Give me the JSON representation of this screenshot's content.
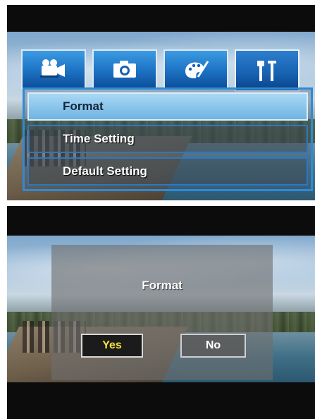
{
  "setup_screen": {
    "tabs": [
      {
        "icon": "movie-camera-icon",
        "active": false
      },
      {
        "icon": "camera-icon",
        "active": false
      },
      {
        "icon": "palette-icon",
        "active": false
      },
      {
        "icon": "tools-icon",
        "active": true
      }
    ],
    "menu_items": [
      {
        "label": "Format",
        "selected": true
      },
      {
        "label": "Time Setting",
        "selected": false
      },
      {
        "label": "Default Setting",
        "selected": false
      }
    ]
  },
  "format_dialog": {
    "title": "Format",
    "yes_label": "Yes",
    "no_label": "No",
    "selected": "Yes"
  },
  "colors": {
    "tab_blue": "#1c72c3",
    "menu_border": "#2c8bd9",
    "selected_item": "#a9d8f4",
    "yes_text": "#f2e13a"
  }
}
